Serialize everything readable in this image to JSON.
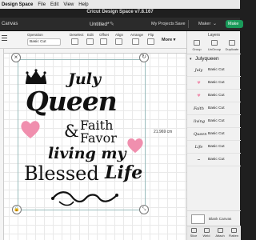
{
  "menubar": {
    "app": "Design Space",
    "items": [
      "File",
      "Edit",
      "View",
      "Help"
    ]
  },
  "window": {
    "title": "Cricut Design Space  v7.8.167"
  },
  "header": {
    "canvas_label": "Canvas",
    "doc_title": "Untitled*",
    "my_projects": "My Projects",
    "save": "Save",
    "machine": "Maker",
    "make_button": "Make"
  },
  "toolbar": {
    "operation_label": "Operation",
    "operation_value": "Basic Cut",
    "deselect_label": "Deselect",
    "edit_label": "Edit",
    "offset_label": "Offset",
    "align_label": "Align",
    "arrange_label": "Arrange",
    "flip_label": "Flip",
    "more_label": "More ▾"
  },
  "canvas": {
    "dimension_label": "21.969 cm",
    "artwork": {
      "line1": "July",
      "line2": "Queen",
      "amp": "&",
      "line3a": "Faith",
      "line3b": "Favor",
      "line4": "living my",
      "line5": "Blessed",
      "line6": "Life"
    },
    "colors": {
      "heart": "#f08fae",
      "ink": "#111111"
    }
  },
  "panel": {
    "title": "Layers",
    "tabs": [
      "Group",
      "UnGroup",
      "Duplicate"
    ],
    "group_name": "Julyqueen",
    "layers": [
      {
        "thumb": "July",
        "label": "Basic Cut"
      },
      {
        "thumb": "♥",
        "label": "Basic Cut"
      },
      {
        "thumb": "♥",
        "label": "Basic Cut"
      },
      {
        "thumb": "Faith",
        "label": "Basic Cut"
      },
      {
        "thumb": "living",
        "label": "Basic Cut"
      },
      {
        "thumb": "Queen",
        "label": "Basic Cut"
      },
      {
        "thumb": "Life",
        "label": "Basic Cut"
      },
      {
        "thumb": "~",
        "label": "Basic Cut"
      }
    ],
    "blank_canvas_label": "Blank Canvas",
    "bottom_actions": [
      "Slice",
      "Weld",
      "Attach",
      "Flatten"
    ]
  }
}
